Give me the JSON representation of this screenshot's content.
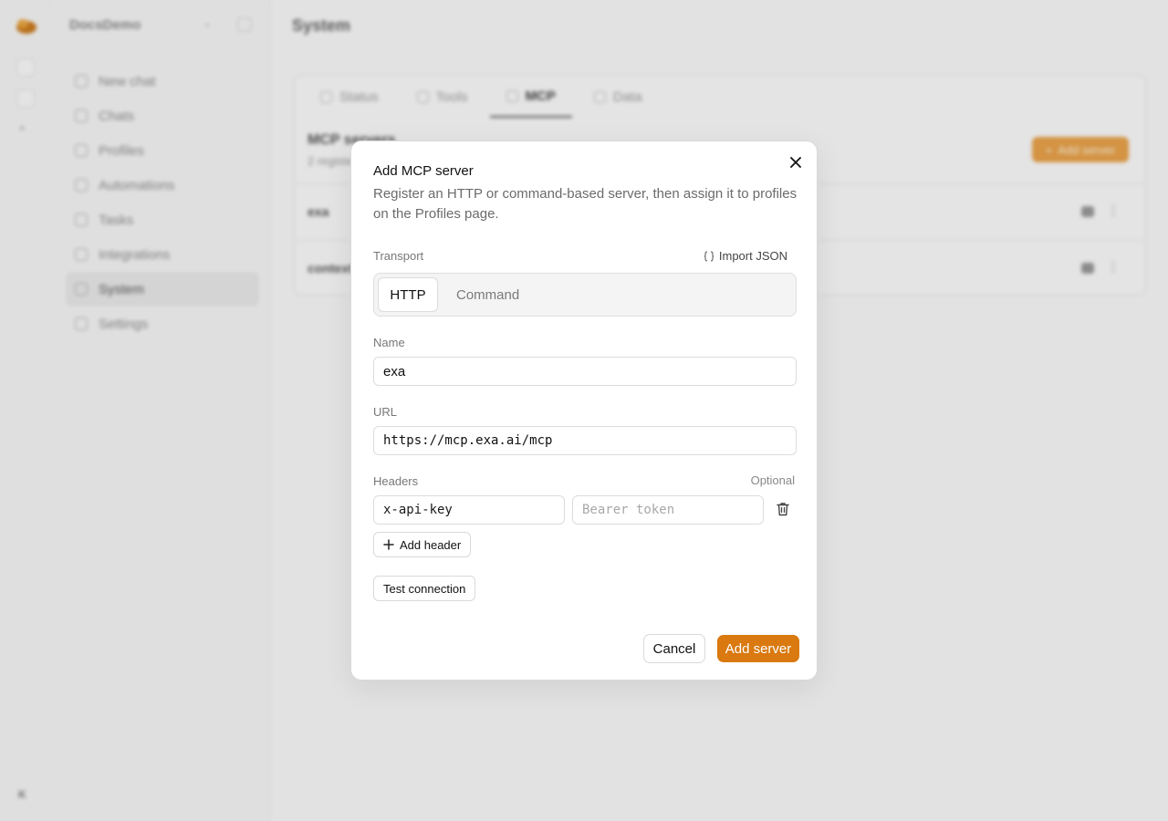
{
  "app": {
    "workspace": "DocsDemo",
    "page_title": "System"
  },
  "sidebar": {
    "items": [
      {
        "label": "New chat"
      },
      {
        "label": "Chats"
      },
      {
        "label": "Profiles"
      },
      {
        "label": "Automations"
      },
      {
        "label": "Tasks"
      },
      {
        "label": "Integrations"
      },
      {
        "label": "System",
        "active": true
      },
      {
        "label": "Settings"
      }
    ]
  },
  "tabs": [
    {
      "label": "Status"
    },
    {
      "label": "Tools"
    },
    {
      "label": "MCP",
      "active": true
    },
    {
      "label": "Data"
    }
  ],
  "mcp": {
    "section_title": "MCP servers",
    "section_sub": "2 registered",
    "add_button": "Add server",
    "rows": [
      {
        "name": "exa"
      },
      {
        "name": "context"
      }
    ]
  },
  "dialog": {
    "title": "Add MCP server",
    "description": "Register an HTTP or command-based server, then assign it to profiles on the Profiles page.",
    "transport_label": "Transport",
    "import_label": "Import JSON",
    "transport_options": {
      "http": "HTTP",
      "command": "Command"
    },
    "selected_transport": "HTTP",
    "name_label": "Name",
    "name_value": "exa",
    "url_label": "URL",
    "url_value": "https://mcp.exa.ai/mcp",
    "headers_label": "Headers",
    "headers_optional": "Optional",
    "header_key": "x-api-key",
    "header_value_placeholder": "Bearer token",
    "add_header": "Add header",
    "test_connection": "Test connection",
    "cancel": "Cancel",
    "submit": "Add server"
  },
  "colors": {
    "accent": "#d9790f"
  }
}
